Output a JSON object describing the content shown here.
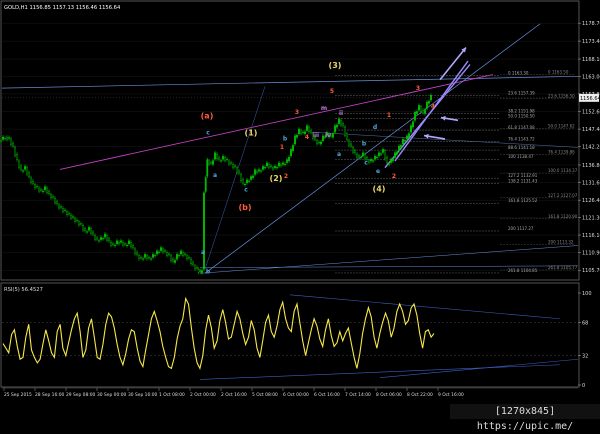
{
  "chart_data": [
    {
      "type": "candlestick",
      "symbol": "GOLD,H1",
      "ohlc": [
        "1156.85",
        "1157.13",
        "1156.46",
        "1156.64"
      ],
      "header_text": "GOLD,H1  1156.85 1157.13 1156.46 1156.64",
      "ylim": [
        1104.0,
        1182.0
      ],
      "y_ticks": [
        "1178.70",
        "1173.40",
        "1168.10",
        "1163.00",
        "1157.80",
        "1152.60",
        "1147.40",
        "1142.20",
        "1136.80",
        "1131.60",
        "1126.40",
        "1121.30",
        "1116.10",
        "1110.90",
        "1105.70"
      ],
      "current_price": "1156.64",
      "x_ticks": [
        "25 Sep 2015",
        "28 Sep 16:00",
        "29 Sep 08:00",
        "30 Sep 00:00",
        "30 Sep 16:00",
        "1 Oct 08:00",
        "2 Oct 00:00",
        "2 Oct 16:00",
        "5 Oct 08:00",
        "6 Oct 00:00",
        "6 Oct 16:00",
        "7 Oct 14:00",
        "8 Oct 06:00",
        "8 Oct 22:00",
        "9 Oct 16:00"
      ],
      "close_path": [
        [
          0,
          1144
        ],
        [
          6,
          1145
        ],
        [
          10,
          1144.5
        ],
        [
          14,
          1142
        ],
        [
          18,
          1138
        ],
        [
          22,
          1135
        ],
        [
          26,
          1136
        ],
        [
          30,
          1133
        ],
        [
          34,
          1131
        ],
        [
          38,
          1130
        ],
        [
          42,
          1129
        ],
        [
          46,
          1130
        ],
        [
          50,
          1128
        ],
        [
          54,
          1127
        ],
        [
          58,
          1125
        ],
        [
          62,
          1124
        ],
        [
          66,
          1123
        ],
        [
          70,
          1122
        ],
        [
          74,
          1121
        ],
        [
          78,
          1120
        ],
        [
          82,
          1119
        ],
        [
          86,
          1117
        ],
        [
          90,
          1118
        ],
        [
          94,
          1116
        ],
        [
          98,
          1114.5
        ],
        [
          102,
          1115
        ],
        [
          106,
          1116
        ],
        [
          110,
          1114
        ],
        [
          114,
          1113
        ],
        [
          118,
          1114
        ],
        [
          122,
          1114
        ],
        [
          126,
          1113
        ],
        [
          130,
          1114
        ],
        [
          134,
          1112
        ],
        [
          138,
          1110
        ],
        [
          142,
          1109
        ],
        [
          146,
          1110
        ],
        [
          150,
          1109
        ],
        [
          154,
          1110
        ],
        [
          158,
          1111
        ],
        [
          162,
          1112
        ],
        [
          166,
          1111
        ],
        [
          170,
          1110
        ],
        [
          174,
          1108
        ],
        [
          178,
          1110
        ],
        [
          182,
          1111
        ],
        [
          186,
          1110
        ],
        [
          190,
          1109
        ],
        [
          194,
          1107
        ],
        [
          198,
          1106
        ],
        [
          201,
          1105
        ],
        [
          203,
          1106
        ],
        [
          205,
          1129
        ],
        [
          208,
          1138
        ],
        [
          212,
          1137
        ],
        [
          216,
          1140
        ],
        [
          220,
          1138
        ],
        [
          224,
          1139
        ],
        [
          228,
          1138
        ],
        [
          232,
          1137
        ],
        [
          236,
          1136
        ],
        [
          240,
          1134
        ],
        [
          244,
          1131
        ],
        [
          248,
          1132
        ],
        [
          252,
          1133
        ],
        [
          256,
          1135
        ],
        [
          260,
          1135
        ],
        [
          264,
          1136
        ],
        [
          268,
          1137
        ],
        [
          272,
          1136
        ],
        [
          276,
          1136
        ],
        [
          280,
          1137
        ],
        [
          284,
          1137
        ],
        [
          288,
          1138
        ],
        [
          292,
          1141
        ],
        [
          296,
          1145
        ],
        [
          300,
          1147
        ],
        [
          304,
          1146
        ],
        [
          308,
          1148
        ],
        [
          312,
          1146
        ],
        [
          316,
          1144
        ],
        [
          320,
          1143
        ],
        [
          324,
          1145
        ],
        [
          328,
          1146
        ],
        [
          332,
          1145
        ],
        [
          336,
          1148
        ],
        [
          340,
          1150
        ],
        [
          344,
          1148
        ],
        [
          348,
          1144
        ],
        [
          352,
          1142
        ],
        [
          356,
          1140
        ],
        [
          360,
          1139
        ],
        [
          364,
          1140
        ],
        [
          368,
          1138
        ],
        [
          372,
          1138
        ],
        [
          376,
          1139
        ],
        [
          380,
          1140
        ],
        [
          384,
          1141
        ],
        [
          388,
          1137
        ],
        [
          392,
          1138
        ],
        [
          396,
          1140
        ],
        [
          400,
          1142
        ],
        [
          404,
          1144
        ],
        [
          408,
          1145
        ],
        [
          412,
          1148
        ],
        [
          416,
          1152
        ],
        [
          420,
          1154
        ],
        [
          424,
          1152
        ],
        [
          428,
          1155
        ],
        [
          432,
          1157
        ]
      ],
      "wave_labels": [
        {
          "text": "(3)",
          "x": 335,
          "price": 1165.5,
          "color": "#e8d36b"
        },
        {
          "text": "(a)",
          "x": 207,
          "price": 1150.5,
          "color": "#ff5a3c"
        },
        {
          "text": "(b)",
          "x": 245,
          "price": 1123.5,
          "color": "#ff5a3c"
        },
        {
          "text": "(1)",
          "x": 251,
          "price": 1145.5,
          "color": "#e8d36b"
        },
        {
          "text": "(2)",
          "x": 276,
          "price": 1132.0,
          "color": "#e8d36b"
        },
        {
          "text": "(4)",
          "x": 379,
          "price": 1129.0,
          "color": "#e8d36b"
        },
        {
          "text": "a",
          "x": 203,
          "price": 1110.5,
          "color": "#49a9e0"
        },
        {
          "text": "b",
          "x": 208,
          "price": 1104.8,
          "color": "#49a9e0"
        },
        {
          "text": "c",
          "x": 208,
          "price": 1145.8,
          "color": "#49a9e0"
        },
        {
          "text": "a",
          "x": 215,
          "price": 1133.2,
          "color": "#49a9e0"
        },
        {
          "text": "c",
          "x": 246,
          "price": 1129.0,
          "color": "#49a9e0"
        },
        {
          "text": "b",
          "x": 285,
          "price": 1144.0,
          "color": "#49a9e0"
        },
        {
          "text": "a",
          "x": 339,
          "price": 1139.5,
          "color": "#49a9e0"
        },
        {
          "text": "c",
          "x": 366,
          "price": 1137.0,
          "color": "#49a9e0"
        },
        {
          "text": "b",
          "x": 364,
          "price": 1142.5,
          "color": "#49a9e0"
        },
        {
          "text": "d",
          "x": 375,
          "price": 1147.5,
          "color": "#49a9e0"
        },
        {
          "text": "e",
          "x": 378,
          "price": 1134.5,
          "color": "#49a9e0"
        },
        {
          "text": "3",
          "x": 297,
          "price": 1151.8,
          "color": "#ff5a3c"
        },
        {
          "text": "m",
          "x": 324,
          "price": 1153.0,
          "color": "#c07ae0"
        },
        {
          "text": "ii",
          "x": 341,
          "price": 1151.5,
          "color": "#c07ae0"
        },
        {
          "text": "iii",
          "x": 316,
          "price": 1145.0,
          "color": "#c07ae0"
        },
        {
          "text": "iv",
          "x": 328,
          "price": 1145.0,
          "color": "#c07ae0"
        },
        {
          "text": "1",
          "x": 282,
          "price": 1141.5,
          "color": "#ff5a3c"
        },
        {
          "text": "2",
          "x": 286,
          "price": 1133.0,
          "color": "#ff5a3c"
        },
        {
          "text": "4",
          "x": 307,
          "price": 1144.5,
          "color": "#ff5a3c"
        },
        {
          "text": "5",
          "x": 332,
          "price": 1158.0,
          "color": "#ff5a3c"
        },
        {
          "text": "1",
          "x": 389,
          "price": 1151.0,
          "color": "#ff5a3c"
        },
        {
          "text": "2",
          "x": 394,
          "price": 1133.0,
          "color": "#ff5a3c"
        },
        {
          "text": "3",
          "x": 418,
          "price": 1159.0,
          "color": "#ff5a3c"
        },
        {
          "text": "4",
          "x": 433,
          "price": 1153.5,
          "color": "#ff5a3c"
        }
      ],
      "fib_levels": [
        {
          "label": "0 1163.30",
          "price": 1163.3
        },
        {
          "label": "23.6 1157.39",
          "price": 1157.4
        },
        {
          "label": "38.2 1151.98",
          "price": 1152.0
        },
        {
          "label": "50.0 1150.50",
          "price": 1150.5
        },
        {
          "label": "61.8 1147.08",
          "price": 1147.1
        },
        {
          "label": "76.4 1143.72",
          "price": 1143.7
        },
        {
          "label": "88.6 1141.18",
          "price": 1141.2
        },
        {
          "label": "100 1138.47",
          "price": 1138.5
        },
        {
          "label": "127.2 1132.91",
          "price": 1132.9
        },
        {
          "label": "138.2 1131.43",
          "price": 1131.4
        },
        {
          "label": "161.8 1125.52",
          "price": 1125.5
        },
        {
          "label": "200 1117.27",
          "price": 1117.3
        },
        {
          "label": "261.8 1104.85",
          "price": 1104.9
        }
      ],
      "right_fib_levels": [
        {
          "label": "0 1163.50",
          "price": 1163.5
        },
        {
          "label": "23.6 1156.50",
          "price": 1156.5
        },
        {
          "label": "50.0 1147.62",
          "price": 1147.6
        },
        {
          "label": "76.4 1139.86",
          "price": 1139.9
        },
        {
          "label": "100.0 1134.37",
          "price": 1134.4
        },
        {
          "label": "127.2 1127.07",
          "price": 1127.1
        },
        {
          "label": "161.8 1120.90",
          "price": 1120.9
        },
        {
          "label": "200 1113.32",
          "price": 1113.3
        },
        {
          "label": "261.8 1105.77",
          "price": 1105.8
        }
      ]
    },
    {
      "type": "line",
      "title": "RSI(5) 56.4527",
      "ylim": [
        0,
        100
      ],
      "y_ticks": [
        "100",
        "68",
        "32",
        "0"
      ],
      "values": [
        45,
        40,
        35,
        55,
        60,
        42,
        28,
        30,
        52,
        66,
        38,
        30,
        24,
        28,
        45,
        60,
        48,
        35,
        30,
        58,
        66,
        40,
        32,
        46,
        60,
        72,
        78,
        58,
        30,
        38,
        62,
        72,
        52,
        30,
        28,
        44,
        66,
        78,
        74,
        62,
        44,
        30,
        22,
        34,
        50,
        60,
        58,
        40,
        26,
        20,
        38,
        55,
        72,
        80,
        70,
        58,
        42,
        30,
        20,
        18,
        30,
        50,
        64,
        72,
        94,
        88,
        62,
        40,
        24,
        18,
        32,
        60,
        76,
        62,
        40,
        48,
        70,
        82,
        68,
        50,
        52,
        66,
        80,
        72,
        56,
        44,
        52,
        70,
        60,
        40,
        30,
        48,
        68,
        76,
        58,
        52,
        64,
        82,
        90,
        72,
        62,
        58,
        80,
        88,
        68,
        48,
        32,
        46,
        60,
        72,
        64,
        50,
        42,
        60,
        72,
        54,
        42,
        46,
        58,
        48,
        56,
        62,
        46,
        30,
        18,
        34,
        56,
        72,
        84,
        74,
        52,
        40,
        56,
        68,
        78,
        70,
        52,
        62,
        80,
        88,
        80,
        66,
        70,
        84,
        88,
        76,
        56,
        40,
        58,
        60,
        52,
        56
      ]
    }
  ],
  "watermark": "[1270x845] https://upic.me/"
}
